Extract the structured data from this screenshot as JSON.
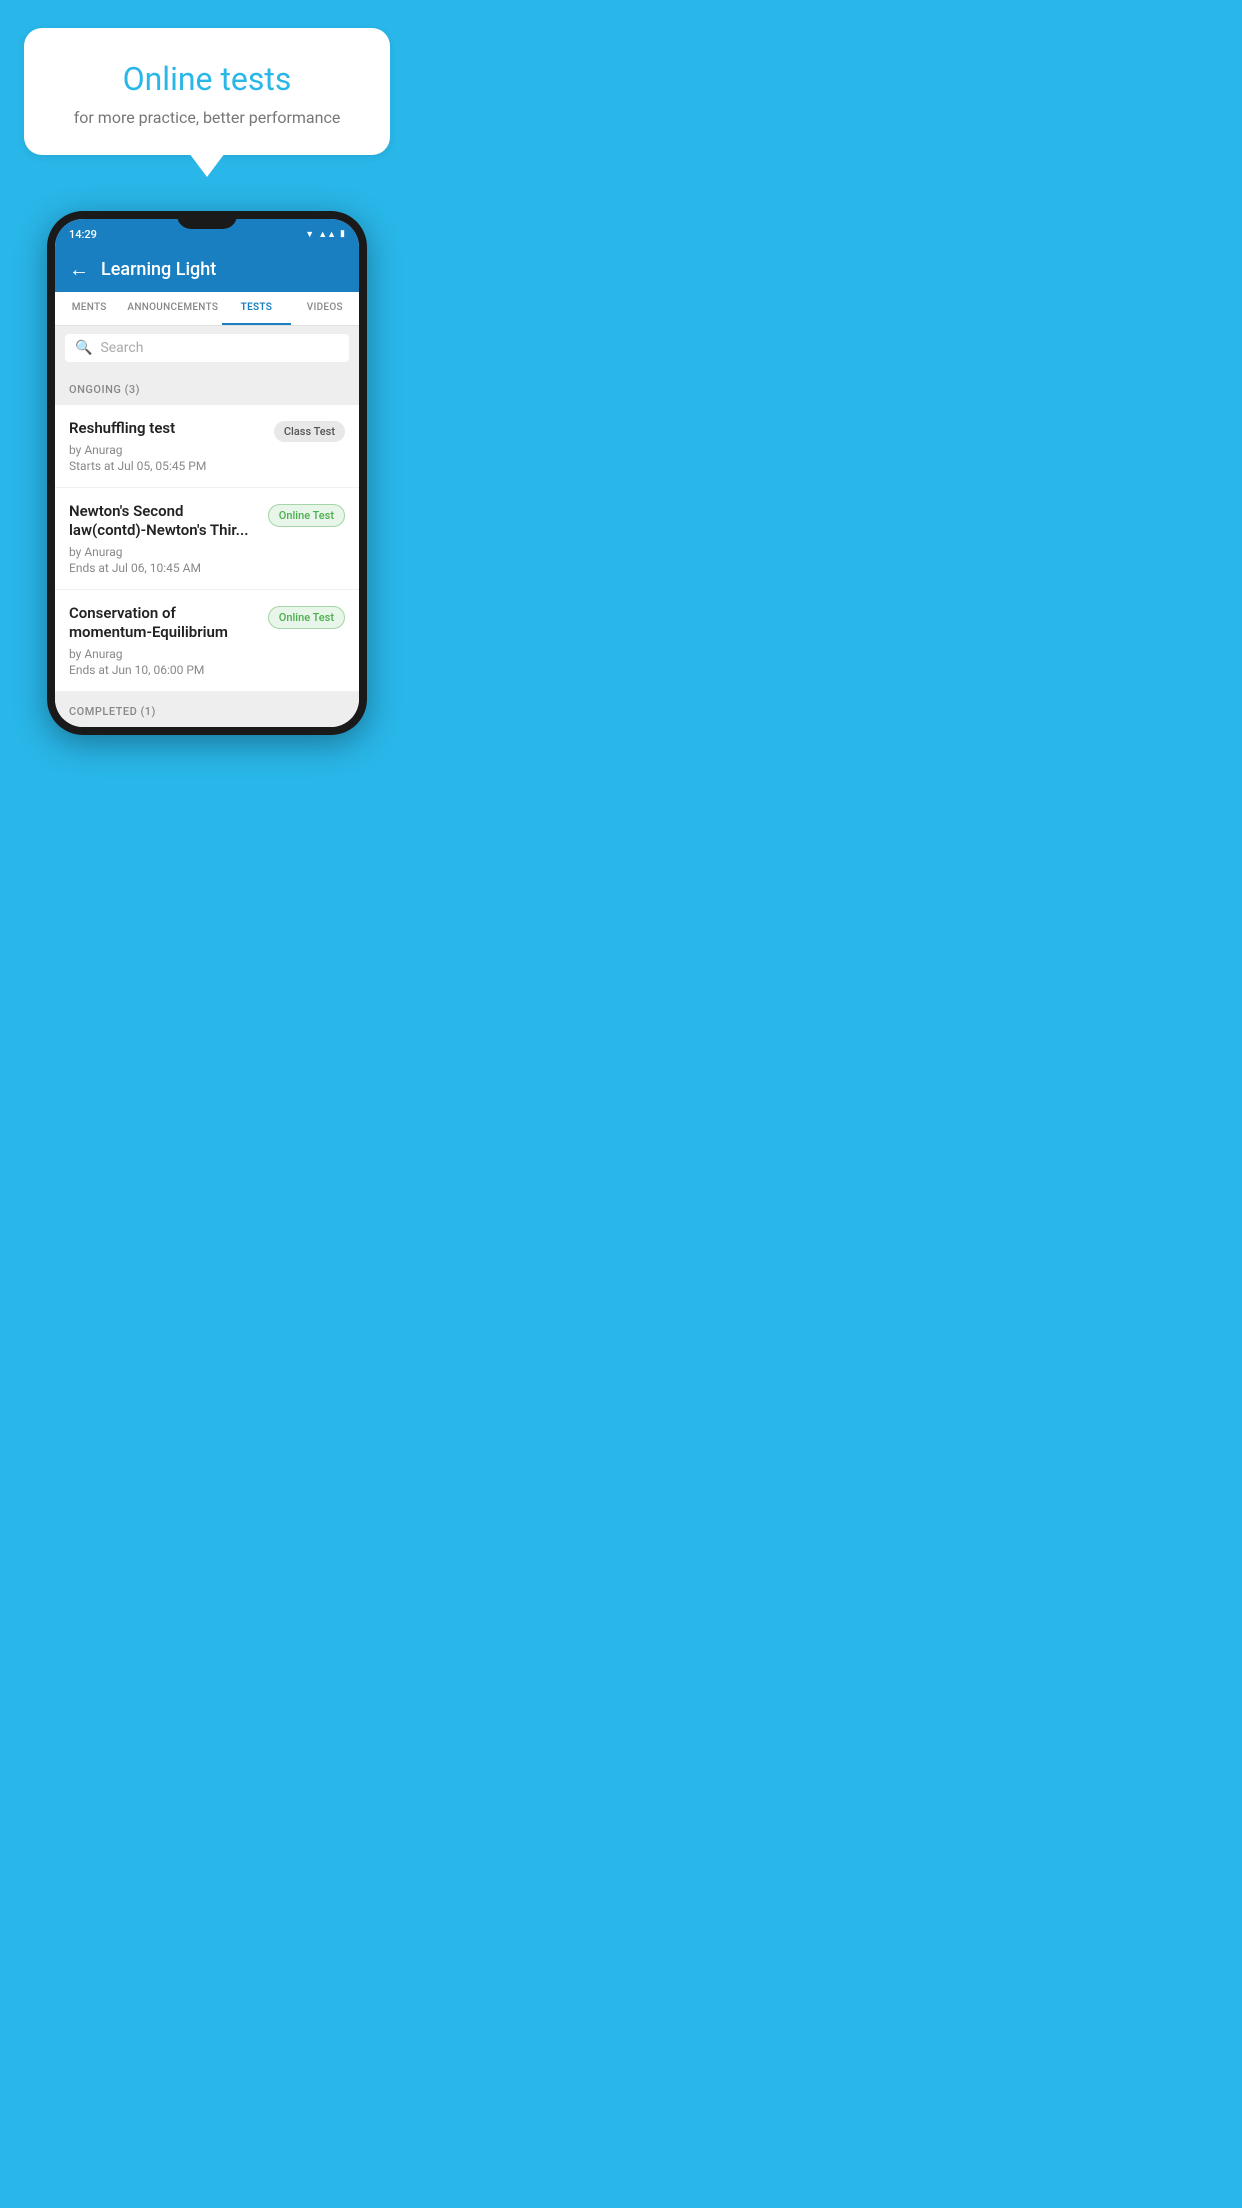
{
  "bubble": {
    "title": "Online tests",
    "subtitle": "for more practice, better performance"
  },
  "phone": {
    "status_time": "14:29",
    "app_title": "Learning Light",
    "tabs": [
      {
        "label": "MENTS",
        "active": false
      },
      {
        "label": "ANNOUNCEMENTS",
        "active": false
      },
      {
        "label": "TESTS",
        "active": true
      },
      {
        "label": "VIDEOS",
        "active": false
      }
    ],
    "search_placeholder": "Search",
    "ongoing_label": "ONGOING (3)",
    "tests": [
      {
        "name": "Reshuffling test",
        "author": "by Anurag",
        "time": "Starts at  Jul 05, 05:45 PM",
        "badge": "Class Test",
        "badge_type": "class"
      },
      {
        "name": "Newton's Second law(contd)-Newton's Thir...",
        "author": "by Anurag",
        "time": "Ends at  Jul 06, 10:45 AM",
        "badge": "Online Test",
        "badge_type": "online"
      },
      {
        "name": "Conservation of momentum-Equilibrium",
        "author": "by Anurag",
        "time": "Ends at  Jun 10, 06:00 PM",
        "badge": "Online Test",
        "badge_type": "online"
      }
    ],
    "completed_label": "COMPLETED (1)"
  }
}
